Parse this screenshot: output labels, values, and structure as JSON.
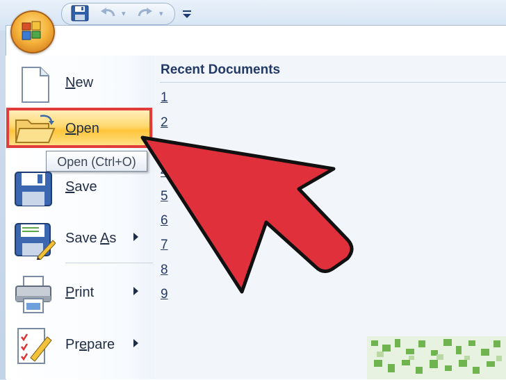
{
  "quick_access": {
    "icons": [
      "save-icon",
      "undo-icon",
      "redo-icon",
      "customize-toolbar-icon"
    ],
    "office_button_icon": "office-logo-icon"
  },
  "menu": {
    "items": [
      {
        "label_pre": "",
        "label_key": "N",
        "label_post": "ew",
        "icon": "new-document-icon",
        "submenu": false
      },
      {
        "label_pre": "",
        "label_key": "O",
        "label_post": "pen",
        "icon": "open-folder-icon",
        "submenu": false,
        "highlighted": true
      },
      {
        "label_pre": "",
        "label_key": "S",
        "label_post": "ave",
        "icon": "save-disk-icon",
        "submenu": false
      },
      {
        "label_pre": "Save ",
        "label_key": "A",
        "label_post": "s",
        "icon": "save-as-icon",
        "submenu": true
      },
      {
        "label_pre": "",
        "label_key": "P",
        "label_post": "rint",
        "icon": "printer-icon",
        "submenu": true
      },
      {
        "label_pre": "Pr",
        "label_key": "e",
        "label_post": "pare",
        "icon": "prepare-icon",
        "submenu": true
      }
    ],
    "tooltip": "Open (Ctrl+O)"
  },
  "recent": {
    "title": "Recent Documents",
    "items": [
      "1",
      "2",
      "4",
      "5",
      "6",
      "7",
      "8",
      "9"
    ]
  },
  "colors": {
    "highlight_border": "#e13c3c",
    "arrow_fill": "#e0303c",
    "text": "#233a66"
  }
}
